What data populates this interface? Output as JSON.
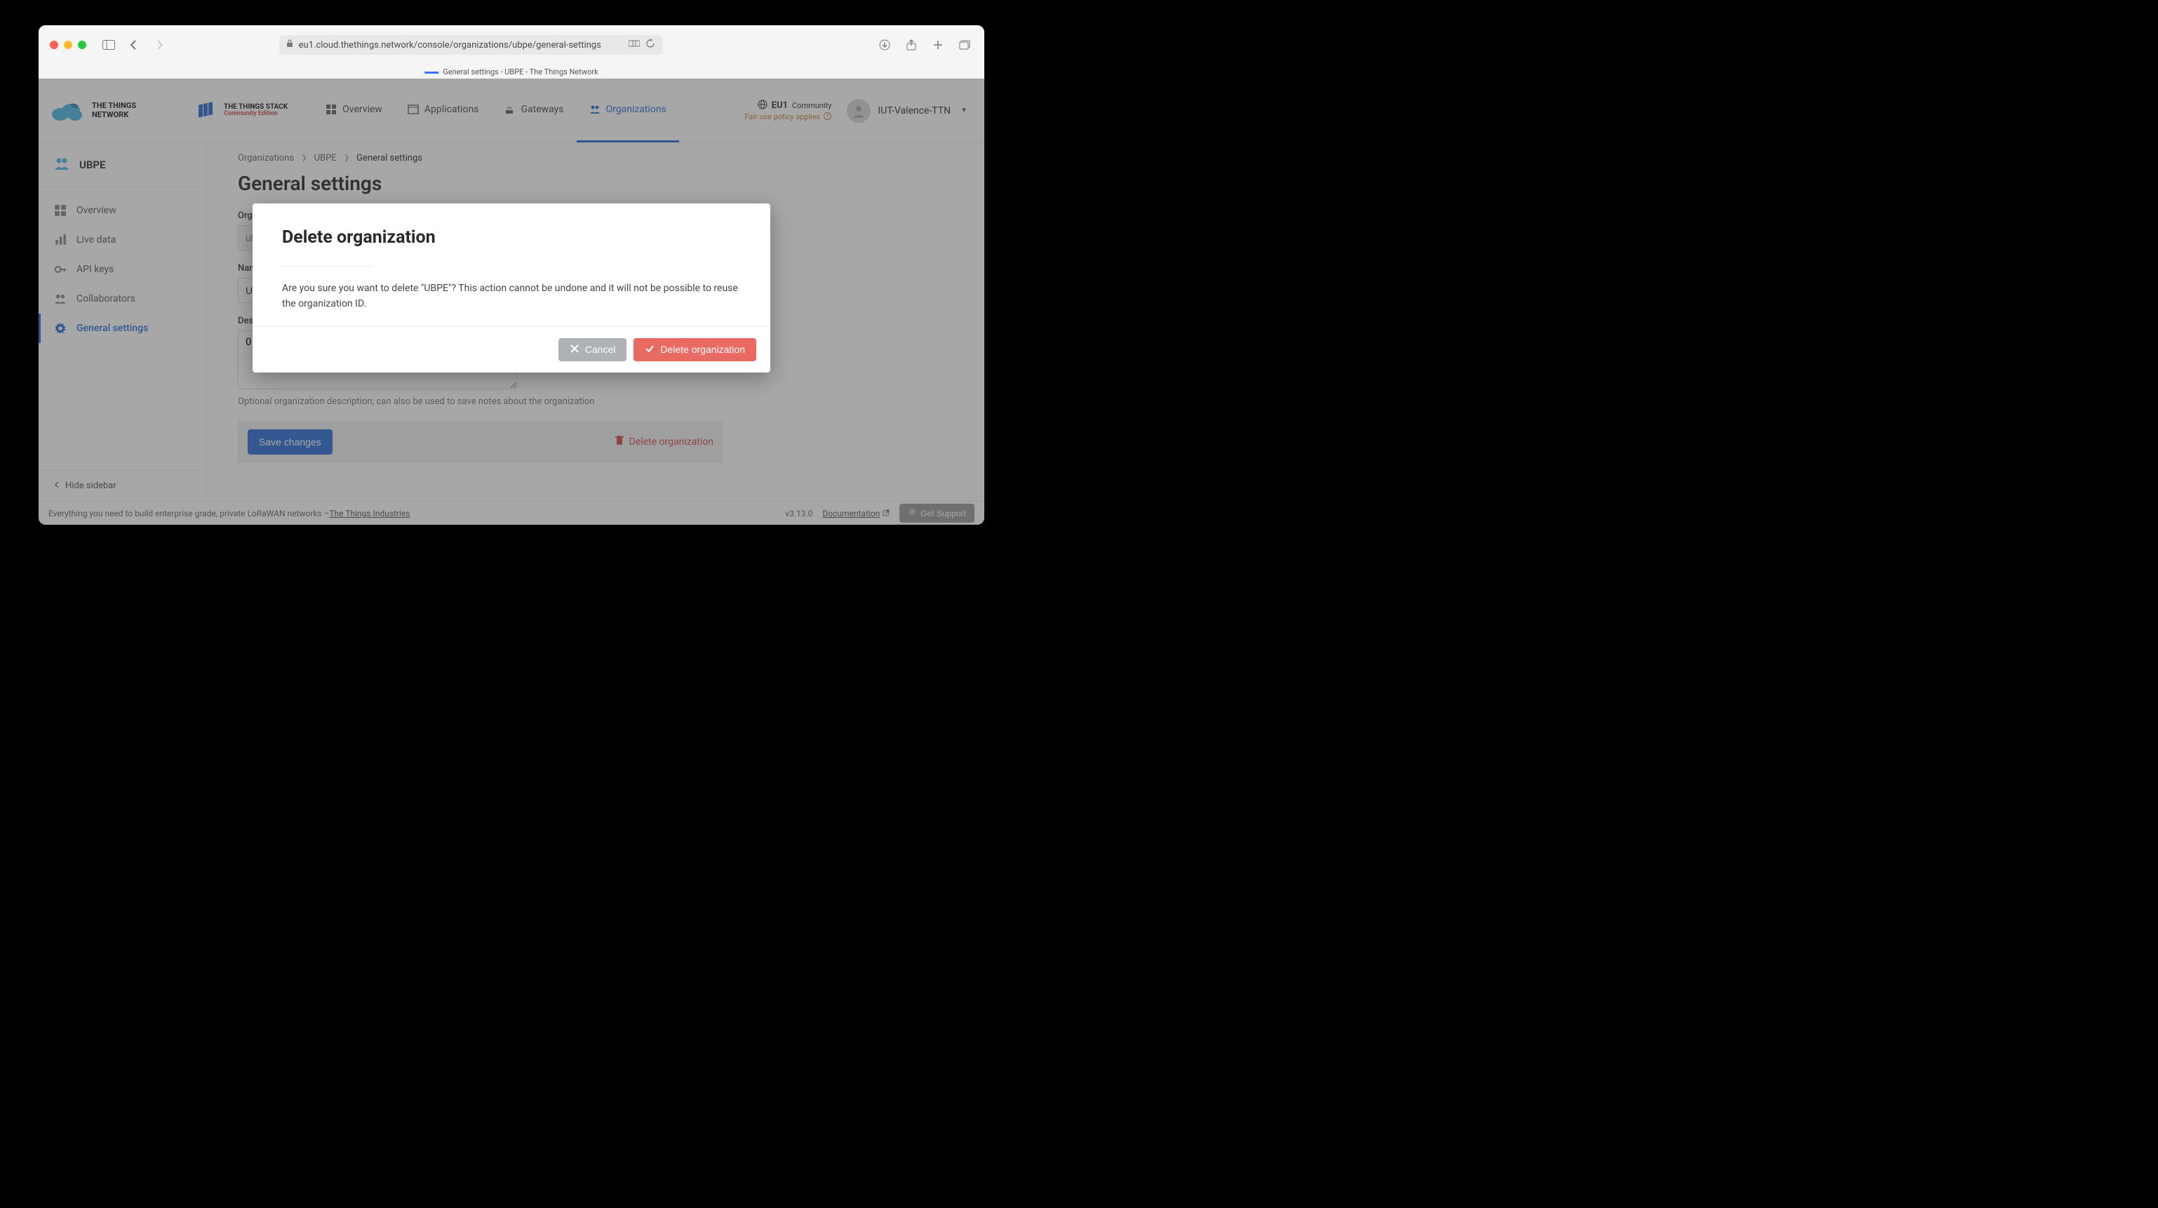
{
  "browser": {
    "url": "eu1.cloud.thethings.network/console/organizations/ubpe/general-settings",
    "tab_title": "General settings - UBPE - The Things Network"
  },
  "logos": {
    "ttn_line1": "THE THINGS",
    "ttn_line2": "NETWORK",
    "stack_line1": "THE THINGS STACK",
    "stack_line2": "Community Edition"
  },
  "nav": {
    "overview": "Overview",
    "applications": "Applications",
    "gateways": "Gateways",
    "organizations": "Organizations"
  },
  "header_right": {
    "cluster_region": "EU1",
    "cluster_label": "Community",
    "fair_use": "Fair use policy applies",
    "username": "IUT-Valence-TTN"
  },
  "sidebar": {
    "org_name": "UBPE",
    "overview": "Overview",
    "live_data": "Live data",
    "api_keys": "API keys",
    "collaborators": "Collaborators",
    "general_settings": "General settings",
    "hide": "Hide sidebar"
  },
  "breadcrumbs": {
    "root": "Organizations",
    "mid": "UBPE",
    "current": "General settings"
  },
  "page": {
    "title": "General settings",
    "org_id_label": "Organization ID",
    "org_id_value": "ubpe",
    "name_label": "Name",
    "name_value": "UBPE",
    "desc_label": "Description",
    "desc_value": "Org",
    "desc_hint": "Optional organization description; can also be used to save notes about the organization",
    "save": "Save changes",
    "delete_link": "Delete organization"
  },
  "footer": {
    "text_prefix": "Everything you need to build enterprise grade, private LoRaWAN networks – ",
    "tti_link": "The Things Industries",
    "version": "v3.13.0",
    "docs": "Documentation",
    "support": "Get Support"
  },
  "modal": {
    "title": "Delete organization",
    "text": "Are you sure you want to delete \"UBPE\"? This action cannot be undone and it will not be possible to reuse the organization ID.",
    "cancel": "Cancel",
    "confirm": "Delete organization"
  }
}
